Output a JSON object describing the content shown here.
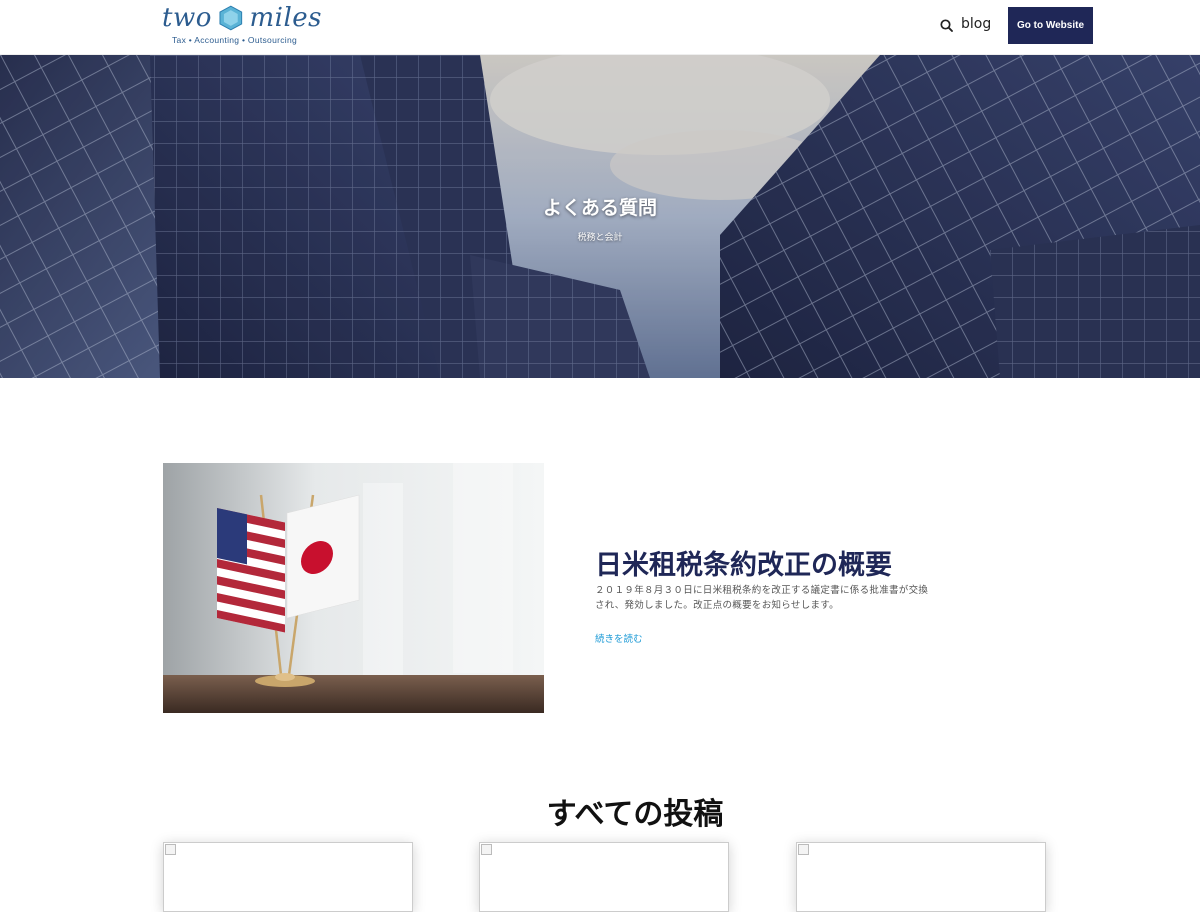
{
  "header": {
    "logo_text_left": "two",
    "logo_text_right": "miles",
    "logo_tagline": "Tax • Accounting • Outsourcing",
    "nav_blog": "blog",
    "cta_label": "Go to Website",
    "search_icon": "search-icon"
  },
  "hero": {
    "title": "よくある質問",
    "subtitle": "税務と会計"
  },
  "featured": {
    "title": "日米租税条約改正の概要",
    "excerpt": "２０１９年８月３０日に日米租税条約を改正する議定書に係る批准書が交換され、発効しました。改正点の概要をお知らせします。",
    "read_more": "続きを読む"
  },
  "posts": {
    "heading": "すべての投稿",
    "cards": [
      "card-1",
      "card-2",
      "card-3"
    ]
  },
  "colors": {
    "navy": "#1f2757",
    "link": "#1c9ad6",
    "logo": "#2c5c8f"
  }
}
